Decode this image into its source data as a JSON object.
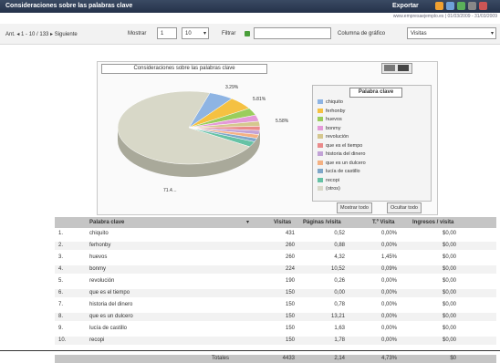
{
  "titlebar": {
    "title": "Consideraciones sobre las palabras clave",
    "export_label": "Exportar"
  },
  "subinfo": "www.empresaejemplo.es | 01/03/2009 - 31/03/2009",
  "controls": {
    "range_text": "Ant. ◂ 1 - 10 / 133 ▸ Siguiente",
    "show_label": "Mostrar",
    "page_value": "1",
    "rows_value": "10",
    "filter_label": "Filtrar",
    "filter_value": "",
    "columns_label": "Columna de gráfico",
    "columns_value": "Visitas"
  },
  "chart": {
    "title": "Consideraciones sobre las palabras clave",
    "legend_title": "Palabra clave",
    "show_all_button": "Mostrar todo",
    "hide_all_button": "Ocultar todo",
    "labels": {
      "top_a": "3.29%",
      "top_b": "5.81%",
      "right": "5.58%",
      "bottom": "71.4…"
    }
  },
  "chart_data": {
    "type": "pie",
    "categories": [
      "chiquito",
      "ferhonby",
      "huevos",
      "bonmy",
      "revolución",
      "que es el tiempo",
      "historia del dinero",
      "que es un dulcero",
      "lucía de castillo",
      "recopi",
      "(otros)"
    ],
    "values": [
      5.58,
      5.81,
      3.29,
      2.8,
      2.2,
      1.9,
      1.8,
      1.7,
      1.6,
      2.4,
      71.4
    ]
  },
  "table": {
    "headers": {
      "keyword": "Palabra clave",
      "visits": "Visitas",
      "pages": "Páginas /visita",
      "avg": "T.º Visita",
      "income": "Ingresos / visita"
    },
    "rows": [
      {
        "n": "1.",
        "keyword": "chiquito",
        "visits": "431",
        "pages": "0,52",
        "avg": "0,00%",
        "income": "$0,00"
      },
      {
        "n": "2.",
        "keyword": "ferhonby",
        "visits": "260",
        "pages": "0,88",
        "avg": "0,00%",
        "income": "$0,00"
      },
      {
        "n": "3.",
        "keyword": "huevos",
        "visits": "260",
        "pages": "4,32",
        "avg": "1,45%",
        "income": "$0,00"
      },
      {
        "n": "4.",
        "keyword": "bonmy",
        "visits": "224",
        "pages": "10,52",
        "avg": "0,09%",
        "income": "$0,00"
      },
      {
        "n": "5.",
        "keyword": "revolución",
        "visits": "190",
        "pages": "0,26",
        "avg": "0,00%",
        "income": "$0,00"
      },
      {
        "n": "6.",
        "keyword": "que es el tiempo",
        "visits": "150",
        "pages": "0,00",
        "avg": "0,00%",
        "income": "$0,00"
      },
      {
        "n": "7.",
        "keyword": "historia del dinero",
        "visits": "150",
        "pages": "0,78",
        "avg": "0,00%",
        "income": "$0,00"
      },
      {
        "n": "8.",
        "keyword": "que es un dulcero",
        "visits": "150",
        "pages": "13,21",
        "avg": "0,00%",
        "income": "$0,00"
      },
      {
        "n": "9.",
        "keyword": "lucía de castillo",
        "visits": "150",
        "pages": "1,63",
        "avg": "0,00%",
        "income": "$0,00"
      },
      {
        "n": "10.",
        "keyword": "recopi",
        "visits": "150",
        "pages": "1,78",
        "avg": "0,00%",
        "income": "$0,00"
      }
    ],
    "totals": {
      "label": "Totales",
      "visits": "4433",
      "pages": "2,14",
      "avg": "4,73%",
      "income": "$0"
    }
  },
  "colors": {
    "slices": [
      "#8eb4e3",
      "#f5c142",
      "#9acd5c",
      "#e49ad8",
      "#d5c78e",
      "#ea8a8a",
      "#c2a3d7",
      "#f4b183",
      "#7fa7c9",
      "#66c2a5",
      "#d8d8c8"
    ]
  }
}
